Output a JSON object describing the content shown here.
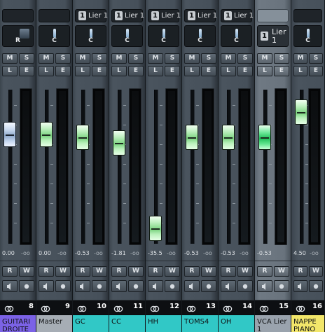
{
  "channels": [
    {
      "link_label": "",
      "pan": "R",
      "fader": "0.00",
      "meter": "-oo",
      "number": "8",
      "name": "GUITARI DROITE",
      "color": "#7b62e6",
      "selected": false,
      "level_pct": 0.77
    },
    {
      "link_label": "",
      "pan": "C",
      "fader": "0.00",
      "meter": "-oo",
      "number": "9",
      "name": "Master",
      "color": "#a6adb5",
      "selected": false,
      "level_pct": 0.77
    },
    {
      "link_badge": "1",
      "link_label": "Lier 1",
      "pan": "C",
      "fader": "-0.53",
      "meter": "-oo",
      "number": "10",
      "name": "GC",
      "color": "#31c8c6",
      "selected": false,
      "level_pct": 0.75
    },
    {
      "link_badge": "1",
      "link_label": "Lier 1",
      "pan": "C",
      "fader": "-1.81",
      "meter": "-oo",
      "number": "11",
      "name": "CC",
      "color": "#31c8c6",
      "selected": false,
      "level_pct": 0.71
    },
    {
      "link_badge": "1",
      "link_label": "Lier 1",
      "pan": "C",
      "fader": "-35.5",
      "meter": "-oo",
      "number": "12",
      "name": "HH",
      "color": "#31c8c6",
      "selected": false,
      "level_pct": 0.1
    },
    {
      "link_badge": "1",
      "link_label": "Lier 1",
      "pan": "C",
      "fader": "-0.53",
      "meter": "-oo",
      "number": "13",
      "name": "TOMS4",
      "color": "#31c8c6",
      "selected": false,
      "level_pct": 0.75
    },
    {
      "link_badge": "1",
      "link_label": "Lier 1",
      "pan": "C",
      "fader": "-0.53",
      "meter": "-oo",
      "number": "14",
      "name": "OH",
      "color": "#31c8c6",
      "selected": false,
      "level_pct": 0.75
    },
    {
      "link_label": "",
      "pan_badge": "1",
      "pan": "Lier 1",
      "fader": "-0.53",
      "meter": "",
      "number": "15",
      "name": "VCA Lier 1",
      "color": "#9aa3ad",
      "selected": true,
      "level_pct": 0.75
    },
    {
      "link_label": "",
      "pan": "C",
      "fader": "4.50",
      "meter": "-oo",
      "number": "16",
      "name": "NAPPE PIANO",
      "color": "#f2e66a",
      "selected": false,
      "level_pct": 0.93
    }
  ],
  "buttons": {
    "mute": "M",
    "solo": "S",
    "listen": "L",
    "edit": "E",
    "read": "R",
    "write": "W"
  },
  "colors": {
    "fader_normal": "#7ad37f",
    "fader_selected": "#1fbf59",
    "fader_master": "#8fa9cc"
  }
}
